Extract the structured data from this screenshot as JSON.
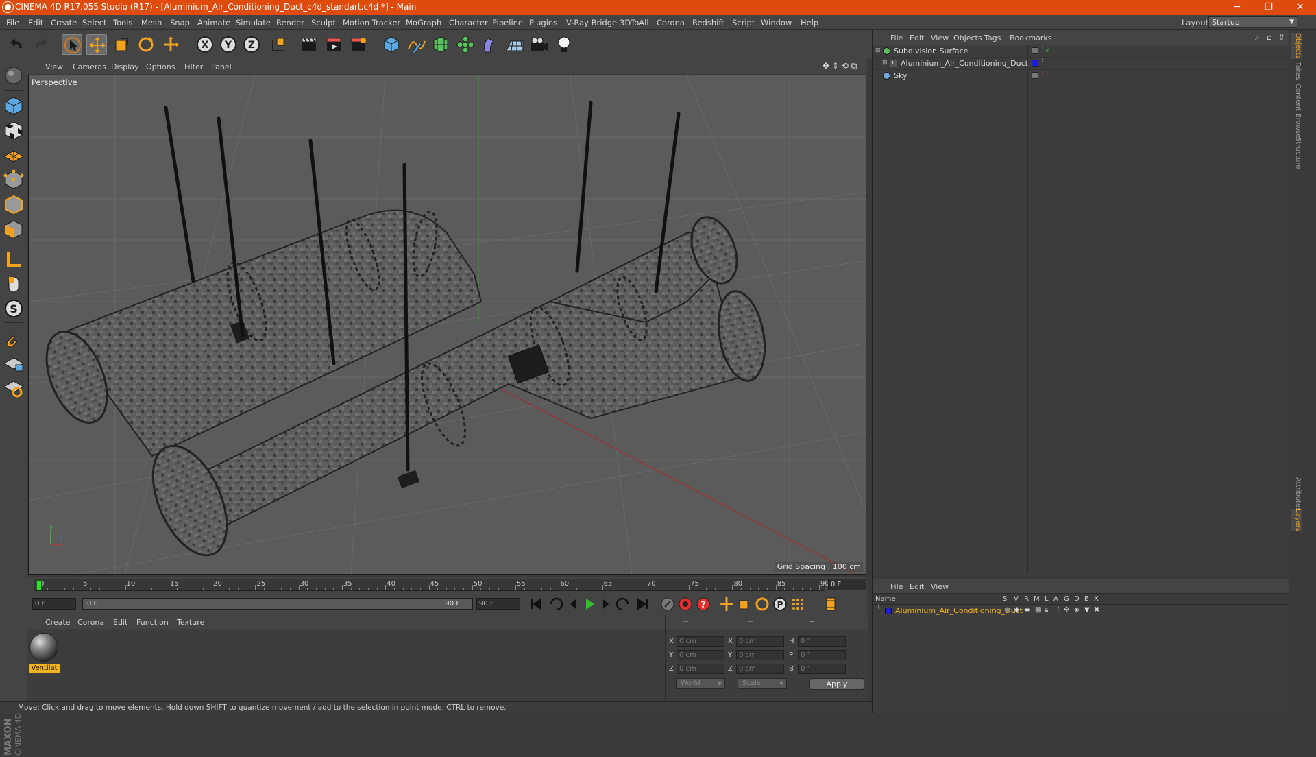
{
  "window": {
    "title": "CINEMA 4D R17.055 Studio (R17) - [Aluminium_Air_Conditioning_Duct_c4d_standart.c4d *] - Main",
    "minimize": "─",
    "restore": "❐",
    "close": "✕"
  },
  "menubar": {
    "items": [
      "File",
      "Edit",
      "Create",
      "Select",
      "Tools",
      "Mesh",
      "Snap",
      "Animate",
      "Simulate",
      "Render",
      "Sculpt",
      "Motion Tracker",
      "MoGraph",
      "Character",
      "Pipeline",
      "Plugins",
      "V-Ray Bridge",
      "3DToAll",
      "Corona",
      "Redshift",
      "Script",
      "Window",
      "Help"
    ],
    "layout_label": "Layout:",
    "layout_value": "Startup"
  },
  "viewport": {
    "menu": [
      "View",
      "Cameras",
      "Display",
      "Options",
      "Filter",
      "Panel"
    ],
    "label": "Perspective",
    "grid_spacing": "Grid Spacing : 100 cm",
    "axis_y": "y",
    "axis_z": "z"
  },
  "timeline": {
    "ticks": [
      "0",
      "5",
      "10",
      "15",
      "20",
      "25",
      "30",
      "35",
      "40",
      "45",
      "50",
      "55",
      "60",
      "65",
      "70",
      "75",
      "80",
      "85",
      "90"
    ],
    "current_frame": "0 F"
  },
  "playbar": {
    "start_field": "0 F",
    "range_start": "0 F",
    "range_end": "90 F",
    "end_field": "90 F"
  },
  "material_panel": {
    "menu": [
      "Create",
      "Corona",
      "Edit",
      "Function",
      "Texture"
    ],
    "materials": [
      {
        "name": "Ventilat"
      }
    ]
  },
  "coordinates": {
    "header": [
      "--",
      "--",
      "--"
    ],
    "rows": [
      {
        "l1": "X",
        "v1": "0 cm",
        "l2": "X",
        "v2": "0 cm",
        "l3": "H",
        "v3": "0 °"
      },
      {
        "l1": "Y",
        "v1": "0 cm",
        "l2": "Y",
        "v2": "0 cm",
        "l3": "P",
        "v3": "0 °"
      },
      {
        "l1": "Z",
        "v1": "0 cm",
        "l2": "Z",
        "v2": "0 cm",
        "l3": "B",
        "v3": "0 °"
      }
    ],
    "space": "World",
    "mode": "Scale",
    "apply": "Apply"
  },
  "status": "Move: Click and drag to move elements. Hold down SHIFT to quantize movement / add to the selection in point mode, CTRL to remove.",
  "objects": {
    "menu": [
      "File",
      "Edit",
      "View",
      "Objects",
      "Tags",
      "Bookmarks"
    ],
    "items": [
      {
        "name": "Subdivision Surface"
      },
      {
        "name": "Aluminium_Air_Conditioning_Duct"
      },
      {
        "name": "Sky"
      }
    ]
  },
  "layers": {
    "menu": [
      "File",
      "Edit",
      "View"
    ],
    "columns": [
      "Name",
      "S",
      "V",
      "R",
      "M",
      "L",
      "A",
      "G",
      "D",
      "E",
      "X"
    ],
    "row": {
      "name": "Aluminium_Air_Conditioning_Duct",
      "color": "#1a1ad8"
    }
  },
  "right_tabs": [
    "Objects",
    "Takes",
    "Content Browser",
    "Structure",
    "Attributes",
    "Layers"
  ],
  "logo": {
    "brand": "MAXON",
    "product": "CINEMA 4D"
  },
  "colors": {
    "title_bar": "#de4b0d",
    "accent": "#f0a020",
    "selection": "#f5b31b"
  }
}
